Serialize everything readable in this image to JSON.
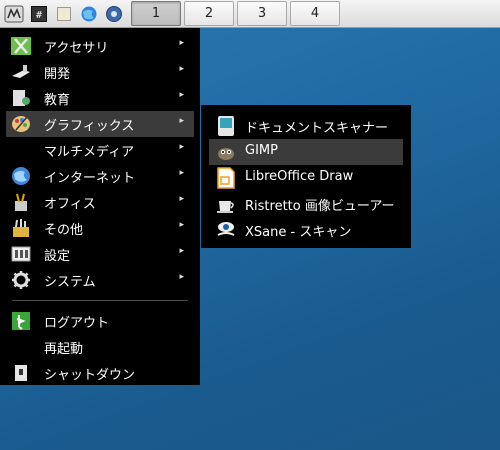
{
  "panel": {
    "launchers": [
      {
        "icon": "menu-icon"
      },
      {
        "icon": "terminal-icon"
      },
      {
        "icon": "file-manager-icon"
      },
      {
        "icon": "browser-icon"
      },
      {
        "icon": "settings-icon"
      }
    ],
    "workspaces": [
      "1",
      "2",
      "3",
      "4"
    ],
    "active_workspace": "1"
  },
  "menu": {
    "items": [
      {
        "label": "アクセサリ",
        "icon": "accessories-icon",
        "arrow": "▸"
      },
      {
        "label": "開発",
        "icon": "development-icon",
        "arrow": "▸"
      },
      {
        "label": "教育",
        "icon": "education-icon",
        "arrow": "▸"
      },
      {
        "label": "グラフィックス",
        "icon": "graphics-icon",
        "arrow": "▸"
      },
      {
        "label": "マルチメディア",
        "icon": "",
        "arrow": "▸"
      },
      {
        "label": "インターネット",
        "icon": "internet-icon",
        "arrow": "▸"
      },
      {
        "label": "オフィス",
        "icon": "office-icon",
        "arrow": "▸"
      },
      {
        "label": "その他",
        "icon": "other-icon",
        "arrow": "▸"
      },
      {
        "label": "設定",
        "icon": "settings-icon",
        "arrow": "▸"
      },
      {
        "label": "システム",
        "icon": "system-icon",
        "arrow": "▸"
      }
    ],
    "actions": [
      {
        "label": "ログアウト",
        "icon": "logout-icon"
      },
      {
        "label": "再起動",
        "icon": ""
      },
      {
        "label": "シャットダウン",
        "icon": "shutdown-icon"
      }
    ]
  },
  "submenu": {
    "items": [
      {
        "label": "ドキュメントスキャナー",
        "icon": "document-scanner-icon"
      },
      {
        "label": "GIMP",
        "icon": "gimp-icon"
      },
      {
        "label": "LibreOffice Draw",
        "icon": "libreoffice-draw-icon"
      },
      {
        "label": "Ristretto 画像ビューアー",
        "icon": "ristretto-icon"
      },
      {
        "label": "XSane - スキャン",
        "icon": "xsane-icon"
      }
    ]
  },
  "colors": {
    "menu_bg": "#000000",
    "highlight": "#3b3b3b",
    "desktop": "#1f68a0"
  }
}
